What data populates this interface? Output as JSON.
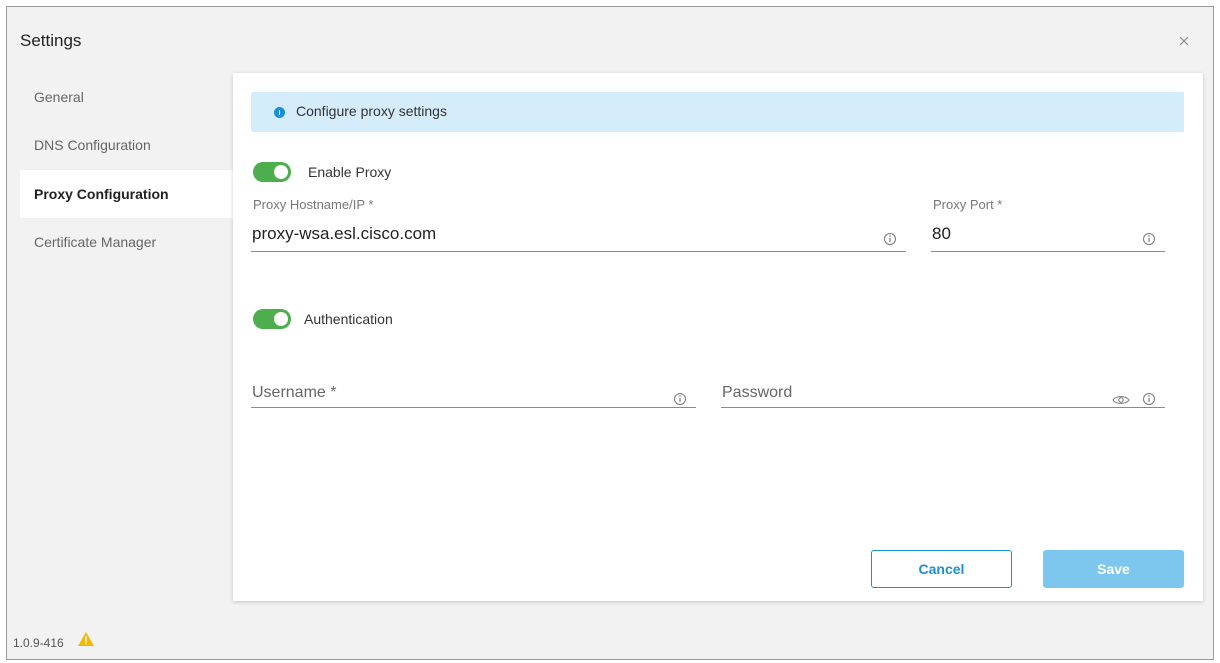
{
  "dialog": {
    "title": "Settings"
  },
  "sidebar": {
    "items": [
      {
        "label": "General"
      },
      {
        "label": "DNS Configuration"
      },
      {
        "label": "Proxy Configuration"
      },
      {
        "label": "Certificate Manager"
      }
    ],
    "active_index": 2
  },
  "banner": {
    "text": "Configure proxy settings"
  },
  "proxy": {
    "enable_label": "Enable Proxy",
    "hostname_label": "Proxy Hostname/IP *",
    "hostname_value": "proxy-wsa.esl.cisco.com",
    "port_label": "Proxy Port *",
    "port_value": "80"
  },
  "auth": {
    "label": "Authentication",
    "username_placeholder": "Username *",
    "password_placeholder": "Password"
  },
  "buttons": {
    "cancel": "Cancel",
    "save": "Save"
  },
  "footer": {
    "version": "1.0.9-416"
  },
  "colors": {
    "accent": "#1b8fd6",
    "toggle_on": "#4cae4c",
    "save_disabled": "#7dc7ee",
    "banner_bg": "#d5ecfb",
    "warning": "#f5b800"
  }
}
